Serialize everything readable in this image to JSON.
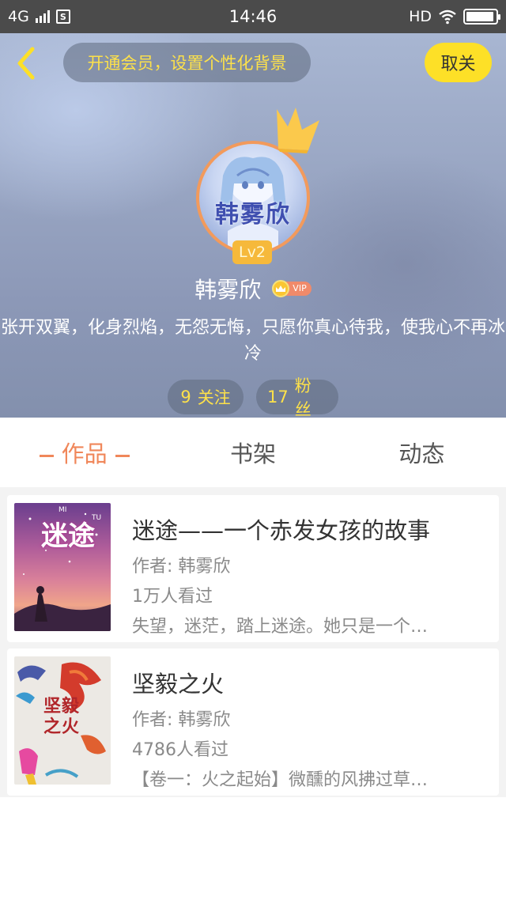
{
  "status_bar": {
    "network": "4G",
    "time": "14:46",
    "hd": "HD",
    "sim_icon": "S",
    "icons": [
      "signal-icon",
      "sim-icon",
      "wifi-icon",
      "battery-icon"
    ]
  },
  "header": {
    "back_icon": "chevron-left-icon",
    "vip_background_text": "开通会员，设置个性化背景",
    "unfollow_label": "取关",
    "level": "Lv2",
    "username": "韩雾欣",
    "vip_label": "VIP",
    "avatar_text": "韩雾欣",
    "bio": "张开双翼，化身烈焰，无怨无悔，只愿你真心待我，使我心不再冰冷",
    "following": {
      "count": "9",
      "label": "关注"
    },
    "fans": {
      "count": "17",
      "label": "粉丝"
    },
    "colors": {
      "accent_yellow": "#fde027",
      "level_badge": "#f6b93b",
      "avatar_border": "#f29a5c"
    }
  },
  "tabs": [
    {
      "label": "作品",
      "active": true
    },
    {
      "label": "书架",
      "active": false
    },
    {
      "label": "动态",
      "active": false
    }
  ],
  "books": [
    {
      "title": "迷途——一个赤发女孩的故事",
      "author": "作者: 韩雾欣",
      "views": "1万人看过",
      "desc": "失望，迷茫，踏上迷途。她只是一个…",
      "cover_text": "迷途",
      "cover_sub_left": "MI",
      "cover_sub_right": "TU"
    },
    {
      "title": "坚毅之火",
      "author": "作者: 韩雾欣",
      "views": "4786人看过",
      "desc": "【卷一：火之起始】微醺的风拂过草…",
      "cover_text": "坚毅之火"
    }
  ],
  "colors": {
    "tab_active": "#f0875a",
    "text_primary": "#333333",
    "text_secondary": "#8a8a8a"
  }
}
